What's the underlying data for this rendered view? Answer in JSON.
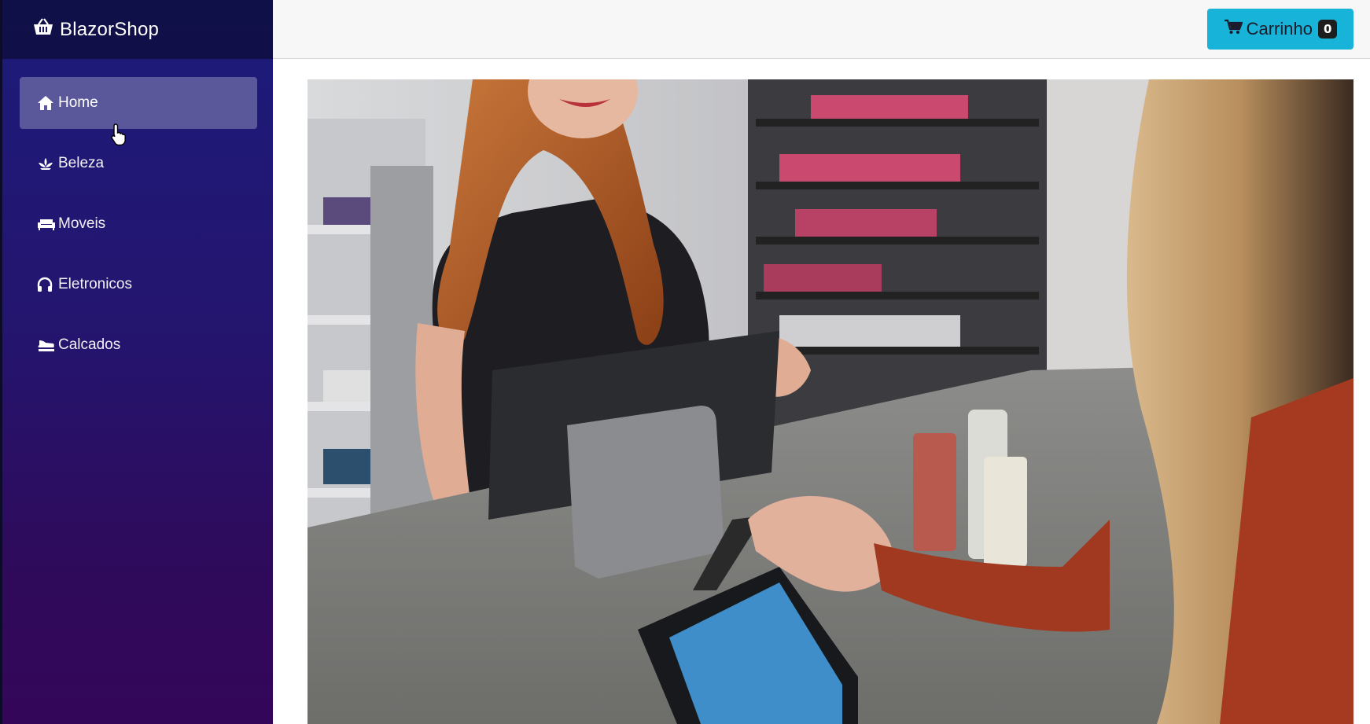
{
  "brand": {
    "name": "BlazorShop",
    "icon": "basket-icon"
  },
  "nav": {
    "items": [
      {
        "label": "Home",
        "icon": "home-icon",
        "active": true
      },
      {
        "label": "Beleza",
        "icon": "lotus-icon",
        "active": false
      },
      {
        "label": "Moveis",
        "icon": "couch-icon",
        "active": false
      },
      {
        "label": "Eletronicos",
        "icon": "headphones-icon",
        "active": false
      },
      {
        "label": "Calcados",
        "icon": "shoe-icon",
        "active": false
      }
    ]
  },
  "header": {
    "cart_label": "Carrinho",
    "cart_count": "0",
    "cart_icon": "cart-icon"
  },
  "colors": {
    "sidebar_top": "#1c1b7a",
    "sidebar_bottom": "#34065a",
    "cart_button": "#18b3d8"
  }
}
